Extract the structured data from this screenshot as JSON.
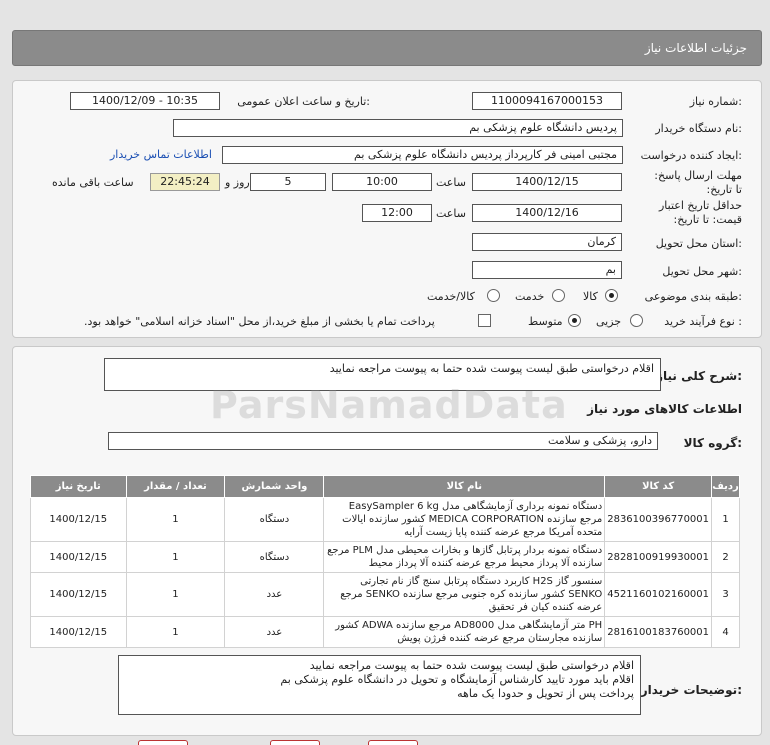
{
  "header": {
    "title": "جزئیات اطلاعات نیاز"
  },
  "form": {
    "need_number_label": "شماره نیاز:",
    "need_number": "1100094167000153",
    "announce_label": "تاریخ و ساعت اعلان عمومی:",
    "announce_value": "1400/12/09 - 10:35",
    "buyer_label": "نام دستگاه خریدار:",
    "buyer_value": "پردیس دانشگاه علوم پزشکی بم",
    "creator_label": "ایجاد کننده درخواست:",
    "creator_value": "مجتبی امینی فر کارپرداز پردیس دانشگاه علوم پزشکی بم",
    "contact_link": "اطلاعات تماس خریدار",
    "deadline_label": "مهلت ارسال پاسخ: تا تاریخ:",
    "deadline_date": "1400/12/15",
    "time_label": "ساعت",
    "deadline_time": "10:00",
    "days_value": "5",
    "days_label": "روز و",
    "remaining_time": "22:45:24",
    "remaining_label": "ساعت باقی مانده",
    "validity_label": "حداقل تاریخ اعتبار قیمت: تا تاریخ:",
    "validity_date": "1400/12/16",
    "validity_time": "12:00",
    "province_label": "استان محل تحویل:",
    "province_value": "کرمان",
    "city_label": "شهر محل تحویل:",
    "city_value": "بم",
    "category_label": "طبقه بندی موضوعی:",
    "category_options": [
      "کالا",
      "خدمت",
      "کالا/خدمت"
    ],
    "category_selected": "کالا",
    "process_label": "نوع فرآیند خرید :",
    "process_options": [
      "جزیی",
      "متوسط"
    ],
    "process_selected": "متوسط",
    "payment_note": "پرداخت تمام یا بخشی از مبلغ خرید،از محل \"اسناد خزانه اسلامی\" خواهد بود."
  },
  "summary": {
    "label": "شرح کلی نیاز:",
    "value": "اقلام درخواستی طبق لیست پیوست شده حتما به پیوست مراجعه نمایید"
  },
  "goods_info_title": "اطلاعات کالاهای مورد نیاز",
  "goods_group": {
    "label": "گروه کالا:",
    "value": "دارو، پزشکی و سلامت"
  },
  "table": {
    "headers": [
      "ردیف",
      "کد کالا",
      "نام کالا",
      "واحد شمارش",
      "تعداد / مقدار",
      "تاریخ نیاز"
    ],
    "rows": [
      {
        "row": "1",
        "code": "2836100396770001",
        "name": "دستگاه نمونه برداری آزمایشگاهی مدل EasySampler 6 kg مرجع سازنده MEDICA CORPORATION کشور سازنده ایالات متحده آمریکا مرجع عرضه کننده پایا زیست آرایه",
        "unit": "دستگاه",
        "qty": "1",
        "date": "1400/12/15"
      },
      {
        "row": "2",
        "code": "2828100919930001",
        "name": "دستگاه نمونه بردار پرتابل گازها و بخارات محیطی مدل PLM مرجع سازنده آلا پرداز محیط مرجع عرضه کننده آلا پرداز محیط",
        "unit": "دستگاه",
        "qty": "1",
        "date": "1400/12/15"
      },
      {
        "row": "3",
        "code": "4521160102160001",
        "name": "سنسور گاز H2S کاربرد دستگاه پرتابل سنج گاز نام تجارتی SENKO کشور سازنده کره جنوبی مرجع سازنده SENKO مرجع عرضه کننده کیان فر تحقیق",
        "unit": "عدد",
        "qty": "1",
        "date": "1400/12/15"
      },
      {
        "row": "4",
        "code": "2816100183760001",
        "name": "PH متر آزمایشگاهی مدل AD8000 مرجع سازنده ADWA کشور سازنده مجارستان مرجع عرضه کننده فرژن پویش",
        "unit": "عدد",
        "qty": "1",
        "date": "1400/12/15"
      }
    ]
  },
  "buyer_notes": {
    "label": "توضیحات خریدار:",
    "lines": [
      "اقلام درخواستی طبق لیست پیوست شده حتما به پیوست مراجعه نمایید",
      "اقلام باید مورد تایید کارشناس آزمایشگاه و تحویل در دانشگاه علوم پزشکی بم",
      "پرداخت پس از تحویل و  حدودا یک ماهه"
    ]
  },
  "watermark": {
    "text": "ParsNamadData"
  }
}
